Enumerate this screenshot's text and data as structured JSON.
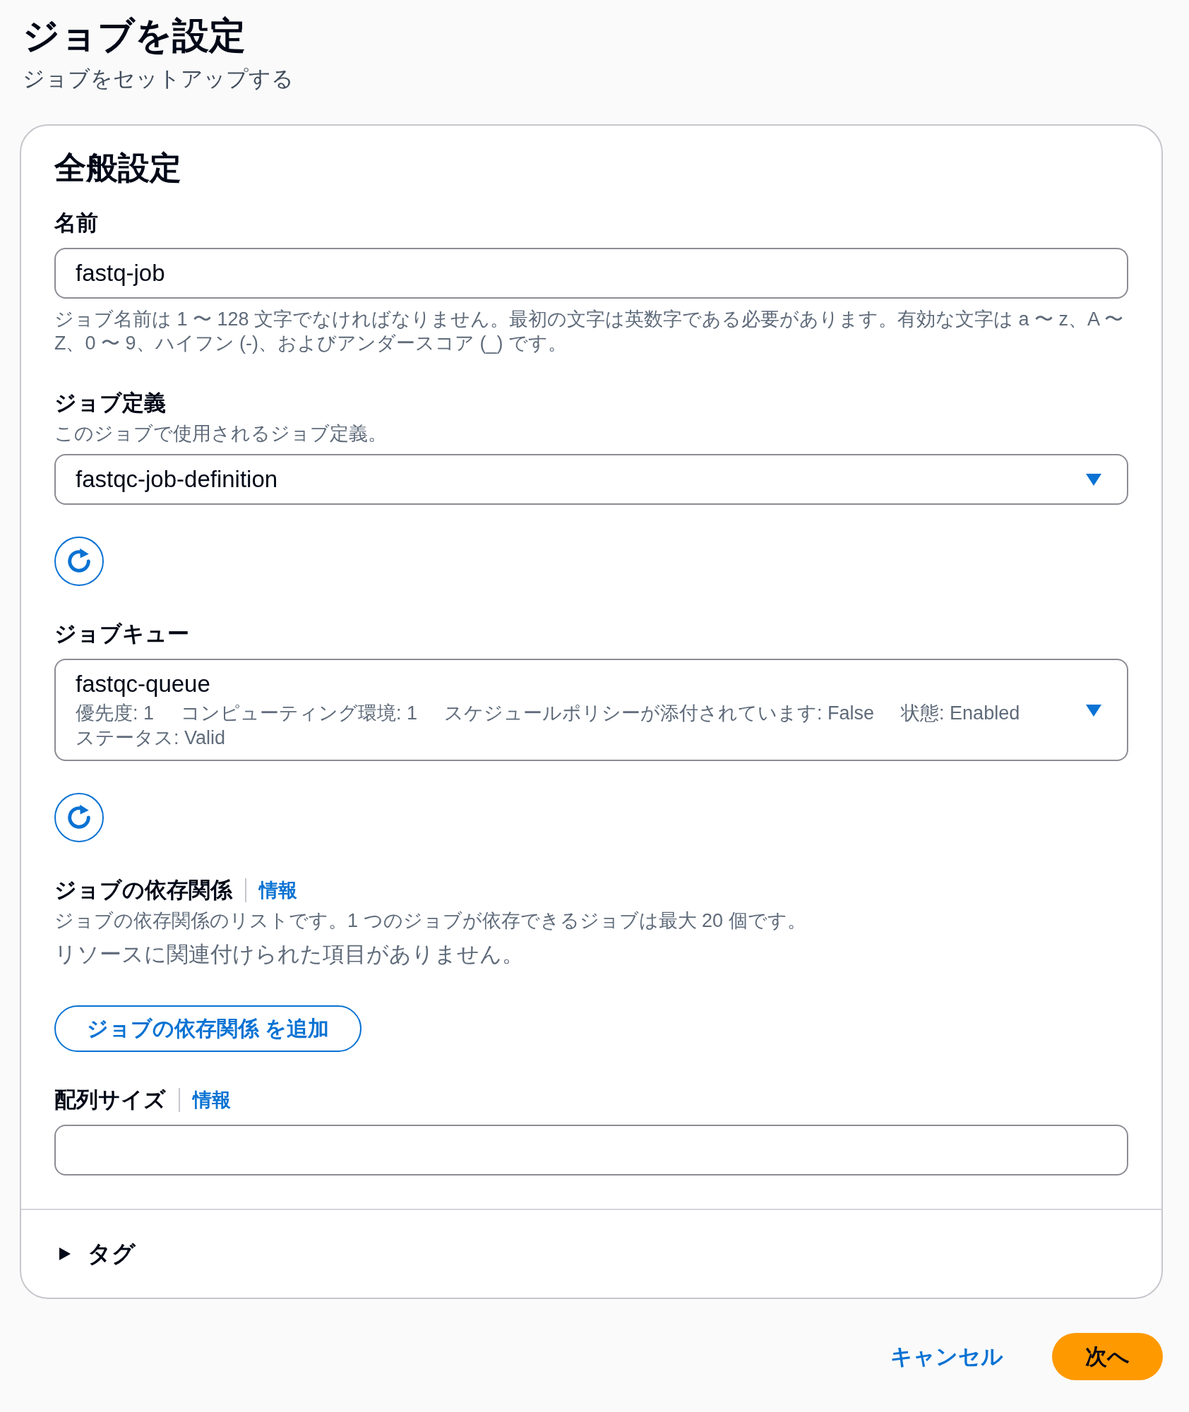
{
  "page": {
    "title": "ジョブを設定",
    "subtitle": "ジョブをセットアップする"
  },
  "general_settings": {
    "heading": "全般設定",
    "fields": [
      {
        "kind": "text",
        "label": "名前",
        "value": "fastq-job",
        "hint": "ジョブ名前は 1 〜 128 文字でなければなりません。最初の文字は英数字である必要があります。有効な文字は a 〜 z、A 〜 Z、0 〜 9、ハイフン (-)、およびアンダースコア (_) です。"
      },
      {
        "kind": "select",
        "label": "ジョブ定義",
        "description": "このジョブで使用されるジョブ定義。",
        "value": "fastqc-job-definition",
        "refresh": true
      },
      {
        "kind": "select",
        "label": "ジョブキュー",
        "value": "fastqc-queue",
        "details": [
          "優先度: 1",
          "コンピューティング環境: 1",
          "スケジュールポリシーが添付されています: False",
          "状態: Enabled",
          "ステータス: Valid"
        ],
        "refresh": true
      },
      {
        "kind": "list",
        "label": "ジョブの依存関係",
        "info": "情報",
        "description": "ジョブの依存関係のリストです。1 つのジョブが依存できるジョブは最大 20 個です。",
        "empty_text": "リソースに関連付けられた項目がありません。",
        "add_button": "ジョブの依存関係 を追加"
      },
      {
        "kind": "text",
        "label": "配列サイズ",
        "info": "情報"
      }
    ]
  },
  "tags": {
    "label": "タグ",
    "expanded": false
  },
  "footer": {
    "buttons": [
      {
        "kind": "link",
        "label": "キャンセル"
      },
      {
        "kind": "primary",
        "label": "次へ"
      }
    ]
  }
}
